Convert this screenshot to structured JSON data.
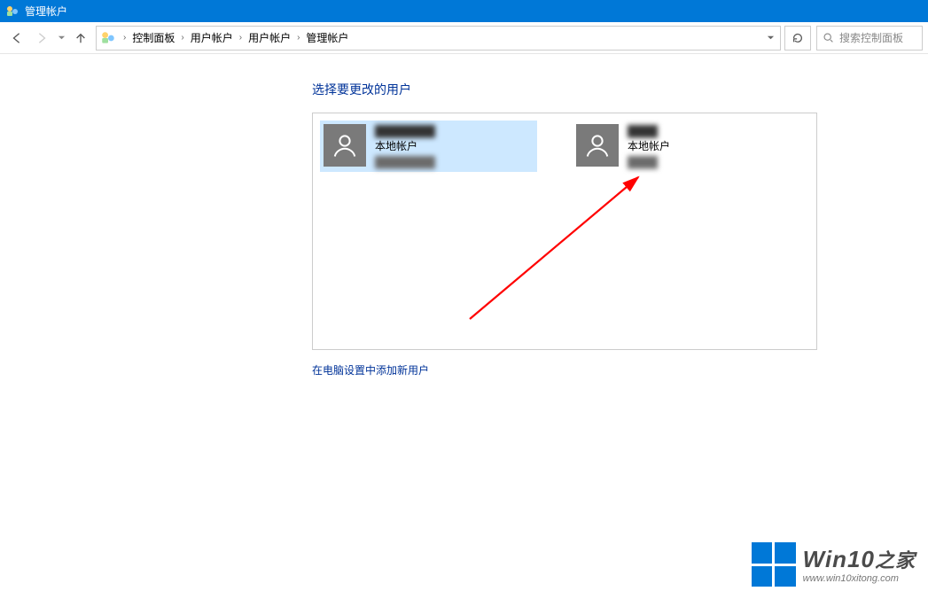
{
  "titlebar": {
    "title": "管理帐户"
  },
  "breadcrumbs": {
    "items": [
      "控制面板",
      "用户帐户",
      "用户帐户",
      "管理帐户"
    ]
  },
  "search": {
    "placeholder": "搜索控制面板"
  },
  "page": {
    "heading": "选择要更改的用户",
    "add_user_link": "在电脑设置中添加新用户"
  },
  "accounts": [
    {
      "name": "████████",
      "type": "本地帐户",
      "role": "████████",
      "selected": true
    },
    {
      "name": "████",
      "type": "本地帐户",
      "role": "████",
      "selected": false
    }
  ],
  "watermark": {
    "title_en": "Win10",
    "title_zh": "之家",
    "url": "www.win10xitong.com"
  }
}
